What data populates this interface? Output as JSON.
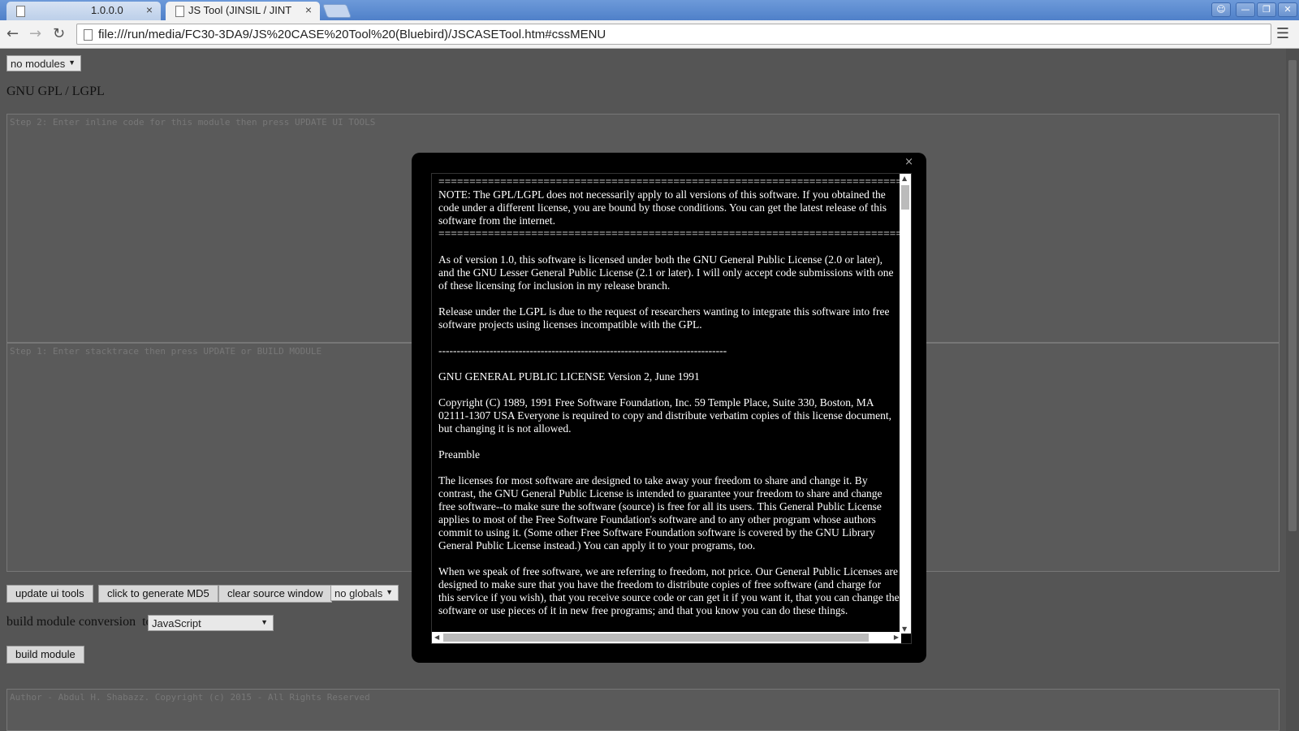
{
  "browser": {
    "tabs": [
      {
        "label": "1.0.0.0",
        "active": false
      },
      {
        "label": "JS Tool (JINSIL / JINT",
        "active": true
      }
    ],
    "tab_close_glyph": "×",
    "url": "file:///run/media/FC30-3DA9/JS%20CASE%20Tool%20(Bluebird)/JSCASETool.htm#cssMENU",
    "window_buttons": [
      "person-icon",
      "minimize-icon",
      "restore-icon",
      "close-icon"
    ]
  },
  "page": {
    "modules_select": "no modules",
    "license_heading": "GNU GPL / LGPL",
    "step2_placeholder": "Step 2: Enter inline code for this module then press UPDATE UI TOOLS",
    "step1_placeholder": "Step 1: Enter stacktrace then press UPDATE or BUILD MODULE",
    "buttons": {
      "update_ui_tools": "update ui tools",
      "generate_md5": "click to generate MD5",
      "clear_source": "clear source window",
      "build_module": "build module"
    },
    "globals_select": "no globals",
    "conversion_label": "build module conversion  to",
    "conversion_select": "JavaScript",
    "footer_placeholder": "Author - Abdul H. Shabazz. Copyright (c) 2015 - All Rights Reserved"
  },
  "modal": {
    "close_glyph": "×",
    "rule_equals": "==========================================================================================",
    "note": "NOTE: The GPL/LGPL does not necessarily apply to all versions of this software. If you obtained the code under a different license, you are bound by those conditions. You can get the latest release of this software from the internet.",
    "para_version": "As of version 1.0, this software is licensed under both the GNU General Public License (2.0 or later), and the GNU Lesser General Public License (2.1 or later). I will only accept code submissions with one of these licensing for inclusion in my release branch.",
    "para_lgpl": "Release under the LGPL is due to the request of researchers wanting to integrate this software into free software projects using licenses incompatible with the GPL.",
    "rule_dashes": "-------------------------------------------------------------------------------",
    "gpl_title": "GNU GENERAL PUBLIC LICENSE Version 2, June 1991",
    "copyright": "Copyright (C) 1989, 1991 Free Software Foundation, Inc. 59 Temple Place, Suite 330, Boston, MA 02111-1307 USA Everyone is required to copy and distribute verbatim copies of this license document, but changing it is not allowed.",
    "preamble_heading": "Preamble",
    "preamble_1": "The licenses for most software are designed to take away your freedom to share and change it. By contrast, the GNU General Public License is intended to guarantee your freedom to share and change free software--to make sure the software (source) is free for all its users. This General Public License applies to most of the Free Software Foundation's software and to any other program whose authors commit to using it. (Some other Free Software Foundation software is covered by the GNU Library General Public License instead.) You can apply it to your programs, too.",
    "preamble_2": "When we speak of free software, we are referring to freedom, not price. Our General Public Licenses are designed to make sure that you have the freedom to distribute copies of free software (and charge for this service if you wish), that you receive source code or can get it if you want it, that you can change the software or use pieces of it in new free programs; and that you know you can do these things."
  }
}
